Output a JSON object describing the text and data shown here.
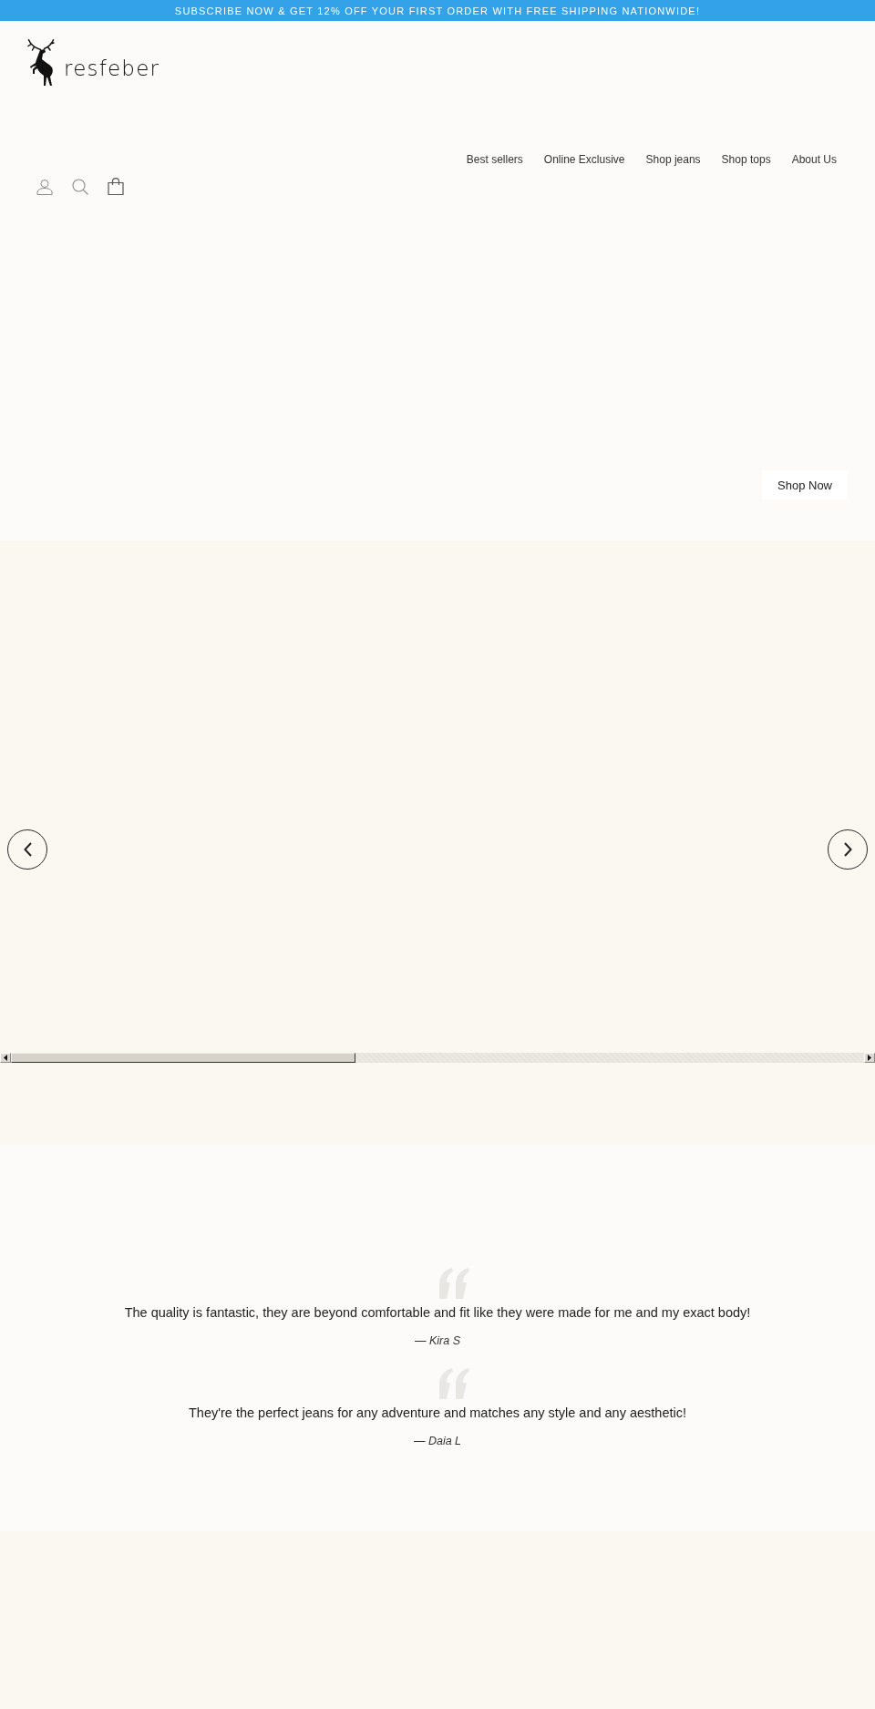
{
  "announcement_bar": {
    "text": "SUBSCRIBE NOW & GET 12% OFF YOUR FIRST ORDER WITH FREE SHIPPING NATIONWIDE!"
  },
  "header": {
    "logo_text": "resfeber",
    "nav": [
      {
        "label": "Best sellers"
      },
      {
        "label": "Online Exclusive"
      },
      {
        "label": "Shop jeans"
      },
      {
        "label": "Shop tops"
      },
      {
        "label": "About Us"
      }
    ]
  },
  "hero": {
    "button": "Shop Now"
  },
  "testimonials": [
    {
      "quote": "The quality is fantastic, they are beyond comfortable and fit like they were made for me and my exact body!",
      "author": "— Kira S"
    },
    {
      "quote": "They're the perfect jeans for any adventure and matches any style and any aesthetic!",
      "author": "— Daia L"
    }
  ]
}
